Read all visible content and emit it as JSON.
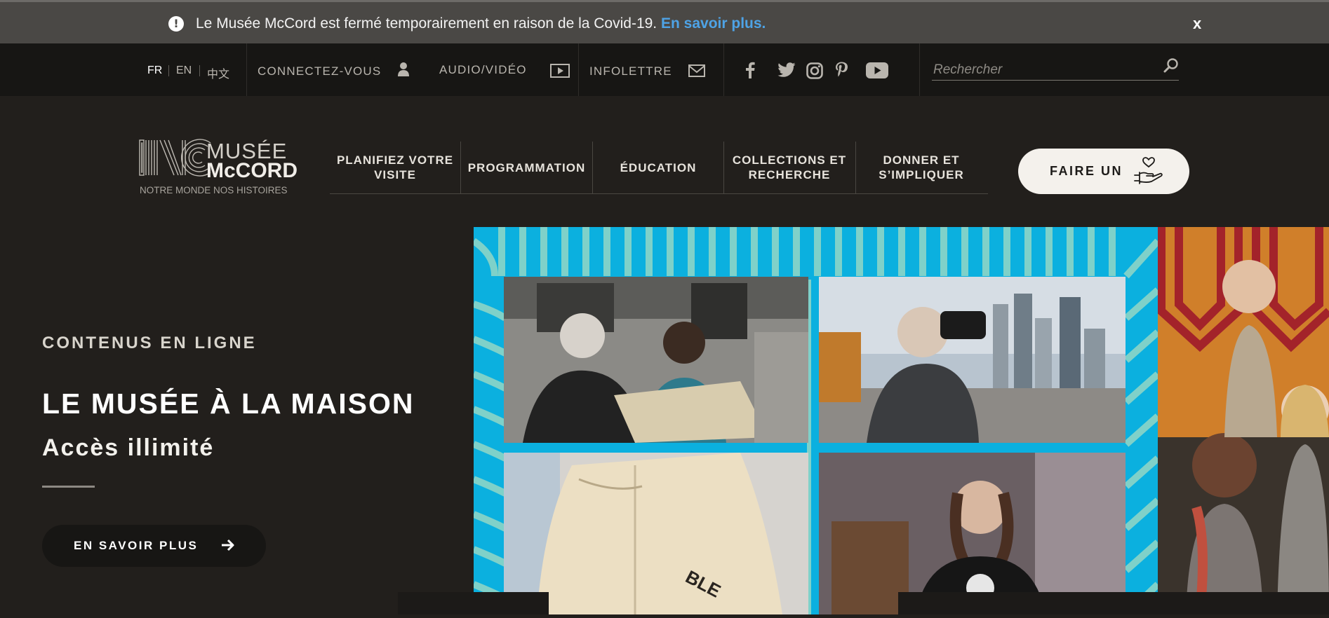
{
  "alert": {
    "message": "Le Musée McCord est fermé temporairement en raison de la Covid-19.",
    "link": "En savoir plus.",
    "close": "x"
  },
  "utility": {
    "languages": [
      "FR",
      "EN",
      "中文"
    ],
    "active_language": "FR",
    "login": "CONNECTEZ-VOUS",
    "audio_video": "AUDIO/VIDÉO",
    "newsletter": "INFOLETTRE",
    "social_icons": [
      "facebook-icon",
      "twitter-icon",
      "instagram-icon",
      "pinterest-icon",
      "youtube-icon"
    ],
    "search_placeholder": "Rechercher"
  },
  "logo": {
    "line1": "MUSÉE",
    "line2": "McCORD",
    "tagline": "NOTRE MONDE NOS HISTOIRES"
  },
  "nav": {
    "items": [
      "PLANIFIEZ VOTRE VISITE",
      "PROGRAMMATION",
      "ÉDUCATION",
      "COLLECTIONS ET RECHERCHE",
      "DONNER ET S’IMPLIQUER"
    ],
    "donate": "FAIRE UN"
  },
  "hero": {
    "eyebrow": "CONTENUS EN LIGNE",
    "title": "LE MUSÉE À LA MAISON",
    "subtitle": "Accès illimité",
    "cta": "EN SAVOIR PLUS",
    "image_text": "BLE"
  },
  "colors": {
    "background": "#221f1c",
    "alert_bar": "#4a4845",
    "utility_bar": "#171614",
    "link_blue": "#4ea3e6",
    "hero_blue": "#0bb0df",
    "hero_teal": "#7fd1c9",
    "donate_button": "#f4f1ec"
  }
}
